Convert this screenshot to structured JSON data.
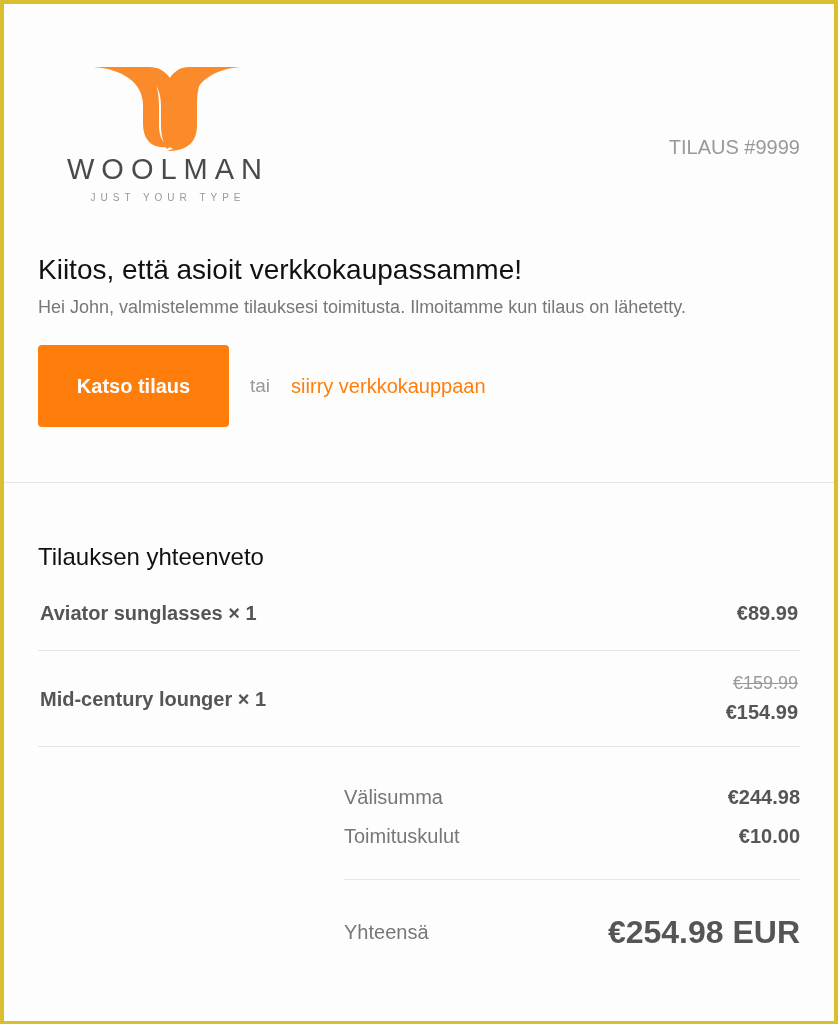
{
  "brand": {
    "name": "WOOLMAN",
    "tagline": "JUST YOUR TYPE"
  },
  "order_number": "TILAUS #9999",
  "heading": "Kiitos, että asioit verkkokaupassamme!",
  "message": "Hei John, valmistelemme tilauksesi toimitusta. Ilmoitamme kun tilaus on lähetetty.",
  "primary_button": "Katso tilaus",
  "separator_text": "tai",
  "store_link": "siirry verkkokauppaan",
  "summary": {
    "title": "Tilauksen yhteenveto",
    "items": [
      {
        "name": "Aviator sunglasses × 1",
        "price": "€89.99"
      },
      {
        "name": "Mid-century lounger × 1",
        "original_price": "€159.99",
        "price": "€154.99"
      }
    ],
    "lines": [
      {
        "label": "Välisumma",
        "value": "€244.98"
      },
      {
        "label": "Toimituskulut",
        "value": "€10.00"
      }
    ],
    "total": {
      "label": "Yhteensä",
      "value": "€254.98 EUR"
    }
  }
}
